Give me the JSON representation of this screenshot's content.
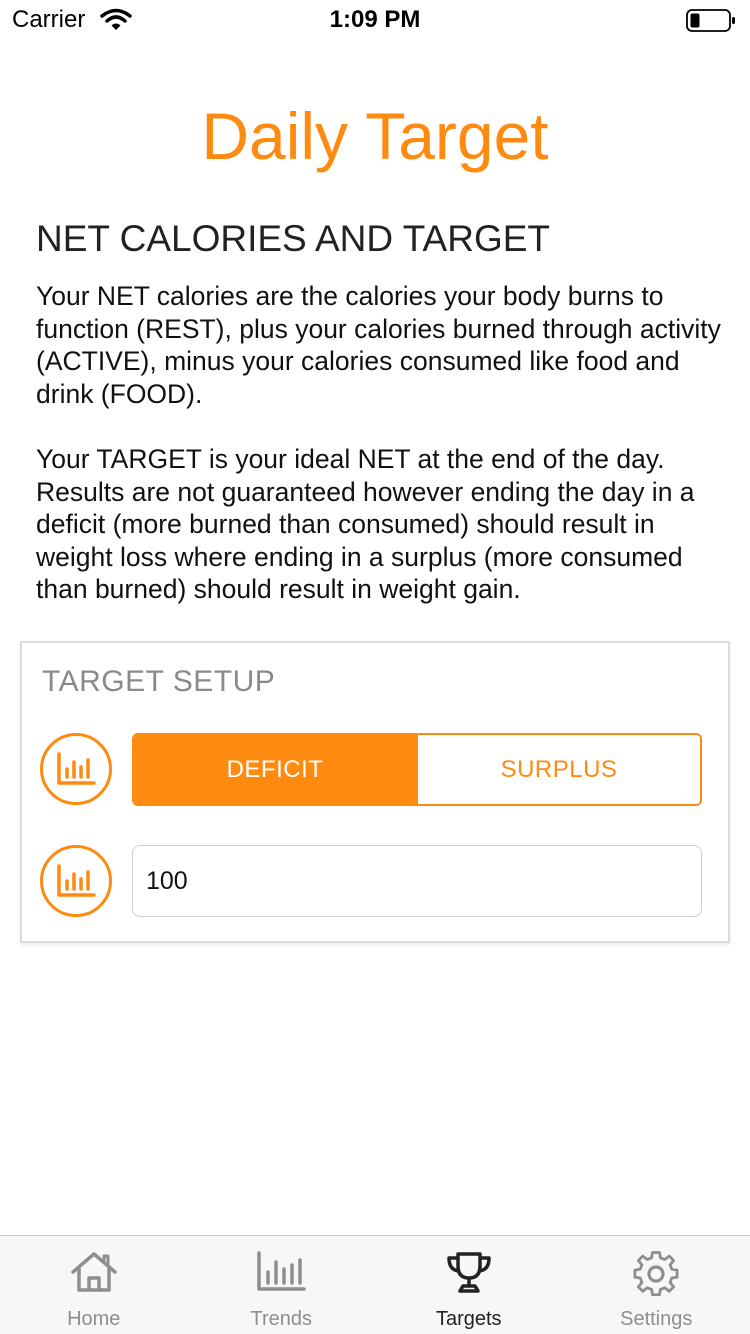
{
  "status_bar": {
    "carrier": "Carrier",
    "time": "1:09 PM"
  },
  "page": {
    "title": "Daily Target",
    "section_heading": "NET CALORIES AND TARGET",
    "paragraph_1": "Your NET calories are the calories your body burns to function (REST), plus your calories burned through activity (ACTIVE), minus your calories consumed like food and drink (FOOD).",
    "paragraph_2": "Your TARGET is your ideal NET at the end of the day. Results are not guaranteed however ending the day in a deficit (more burned than consumed) should result in weight loss where ending in a surplus (more consumed than burned) should result in weight gain."
  },
  "target_setup": {
    "title": "TARGET SETUP",
    "mode_options": [
      "DEFICIT",
      "SURPLUS"
    ],
    "selected_mode": "DEFICIT",
    "target_value": "100"
  },
  "tab_bar": {
    "tabs": [
      {
        "label": "Home",
        "icon": "home-icon"
      },
      {
        "label": "Trends",
        "icon": "bar-chart-icon"
      },
      {
        "label": "Targets",
        "icon": "trophy-icon"
      },
      {
        "label": "Settings",
        "icon": "gear-icon"
      }
    ],
    "active": "Targets"
  },
  "colors": {
    "accent": "#FF8A10",
    "inactive_tab": "#8E8E8E",
    "active_tab": "#222222"
  }
}
